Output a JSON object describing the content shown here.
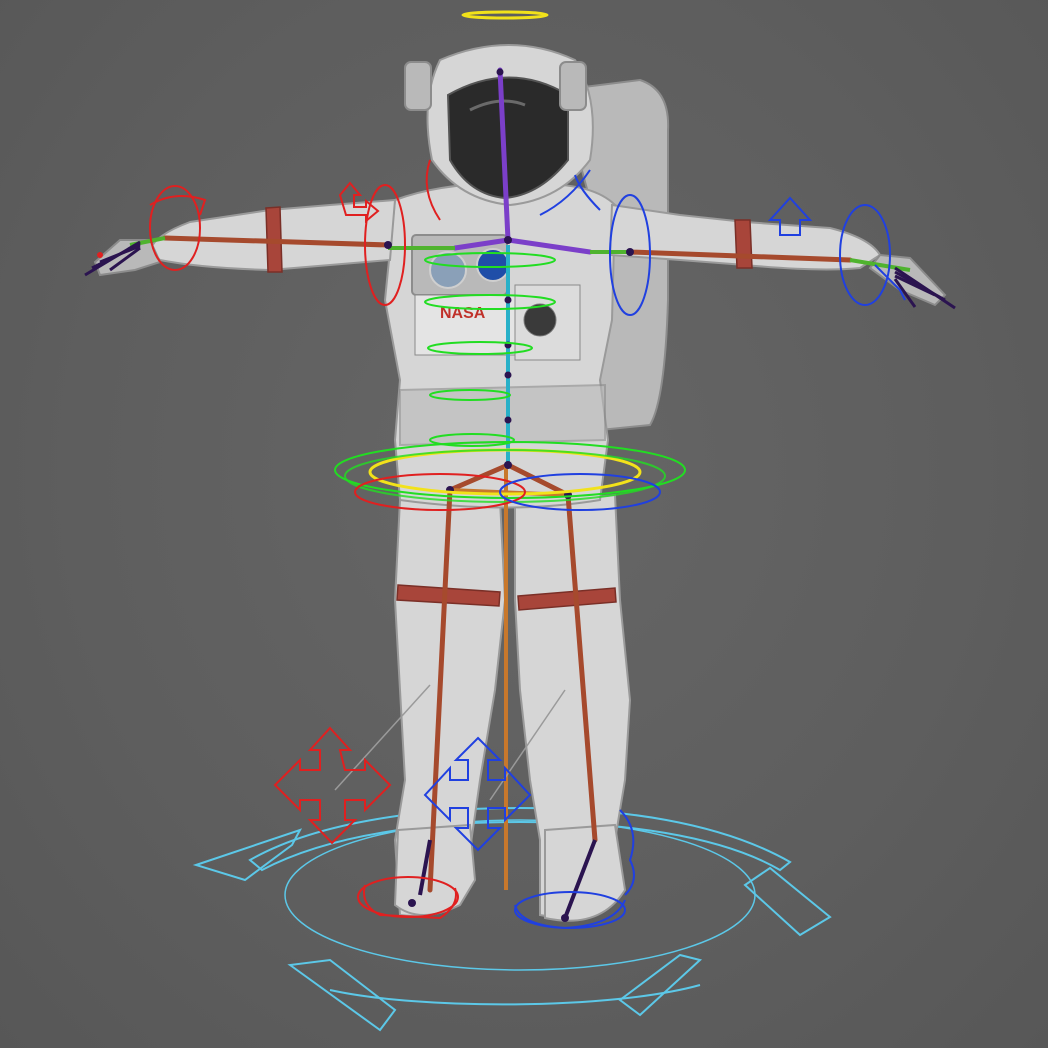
{
  "viewport": {
    "background": "#5f5f5f"
  },
  "model": {
    "patch_text": "NASA"
  },
  "colors": {
    "control_left": "#e02020",
    "control_right": "#2040e0",
    "control_spine": "#22dd22",
    "control_cog": "#f2e21a",
    "control_root": "#5cc8e8",
    "bone_spine": "#7b3fc9",
    "bone_limb": "#a64a2d"
  }
}
